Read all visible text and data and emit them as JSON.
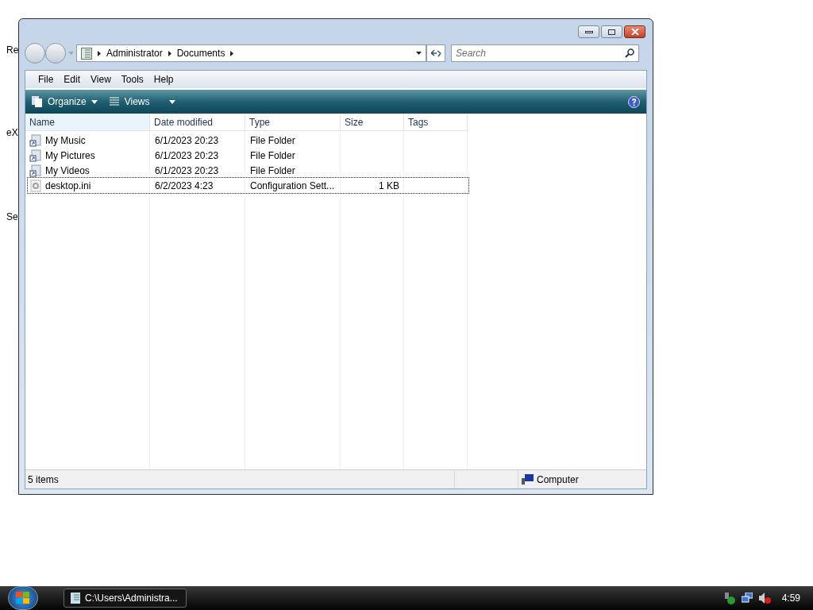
{
  "desktop_icons": [
    {
      "label": "Re"
    },
    {
      "label": "eX"
    },
    {
      "label": "Se"
    }
  ],
  "window": {
    "address": [
      "Administrator",
      "Documents"
    ],
    "search": {
      "placeholder": "Search"
    },
    "menu": [
      "File",
      "Edit",
      "View",
      "Tools",
      "Help"
    ],
    "toolbar": [
      "Organize",
      "Views"
    ],
    "columns": [
      "Name",
      "Date modified",
      "Type",
      "Size",
      "Tags"
    ],
    "rows": [
      {
        "name": "My Music",
        "date": "6/1/2023 20:23",
        "type": "File Folder",
        "kind": "shortcut",
        "focused": false
      },
      {
        "name": "My Pictures",
        "date": "6/1/2023 20:23",
        "type": "File Folder",
        "kind": "shortcut",
        "focused": false
      },
      {
        "name": "My Videos",
        "date": "6/1/2023 20:23",
        "type": "File Folder",
        "kind": "shortcut",
        "focused": false
      },
      {
        "name": "desktop.ini",
        "date": "6/2/2023 4:23",
        "type": "Configuration Sett...",
        "size": "1 KB",
        "kind": "file",
        "focused": true
      }
    ],
    "status_bar": {
      "count": "5 items",
      "zone": "Computer"
    }
  },
  "taskbar": {
    "tasks": [
      {
        "label": "C:\\Users\\Administra..."
      }
    ],
    "clock": "4:59"
  }
}
